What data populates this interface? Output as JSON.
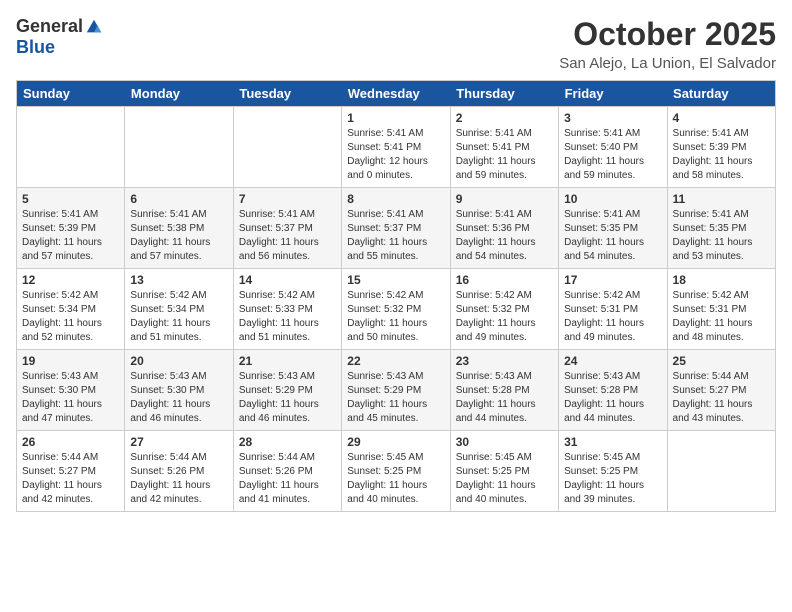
{
  "logo": {
    "general": "General",
    "blue": "Blue"
  },
  "header": {
    "month": "October 2025",
    "location": "San Alejo, La Union, El Salvador"
  },
  "weekdays": [
    "Sunday",
    "Monday",
    "Tuesday",
    "Wednesday",
    "Thursday",
    "Friday",
    "Saturday"
  ],
  "weeks": [
    [
      {
        "day": "",
        "info": ""
      },
      {
        "day": "",
        "info": ""
      },
      {
        "day": "",
        "info": ""
      },
      {
        "day": "1",
        "info": "Sunrise: 5:41 AM\nSunset: 5:41 PM\nDaylight: 12 hours\nand 0 minutes."
      },
      {
        "day": "2",
        "info": "Sunrise: 5:41 AM\nSunset: 5:41 PM\nDaylight: 11 hours\nand 59 minutes."
      },
      {
        "day": "3",
        "info": "Sunrise: 5:41 AM\nSunset: 5:40 PM\nDaylight: 11 hours\nand 59 minutes."
      },
      {
        "day": "4",
        "info": "Sunrise: 5:41 AM\nSunset: 5:39 PM\nDaylight: 11 hours\nand 58 minutes."
      }
    ],
    [
      {
        "day": "5",
        "info": "Sunrise: 5:41 AM\nSunset: 5:39 PM\nDaylight: 11 hours\nand 57 minutes."
      },
      {
        "day": "6",
        "info": "Sunrise: 5:41 AM\nSunset: 5:38 PM\nDaylight: 11 hours\nand 57 minutes."
      },
      {
        "day": "7",
        "info": "Sunrise: 5:41 AM\nSunset: 5:37 PM\nDaylight: 11 hours\nand 56 minutes."
      },
      {
        "day": "8",
        "info": "Sunrise: 5:41 AM\nSunset: 5:37 PM\nDaylight: 11 hours\nand 55 minutes."
      },
      {
        "day": "9",
        "info": "Sunrise: 5:41 AM\nSunset: 5:36 PM\nDaylight: 11 hours\nand 54 minutes."
      },
      {
        "day": "10",
        "info": "Sunrise: 5:41 AM\nSunset: 5:35 PM\nDaylight: 11 hours\nand 54 minutes."
      },
      {
        "day": "11",
        "info": "Sunrise: 5:41 AM\nSunset: 5:35 PM\nDaylight: 11 hours\nand 53 minutes."
      }
    ],
    [
      {
        "day": "12",
        "info": "Sunrise: 5:42 AM\nSunset: 5:34 PM\nDaylight: 11 hours\nand 52 minutes."
      },
      {
        "day": "13",
        "info": "Sunrise: 5:42 AM\nSunset: 5:34 PM\nDaylight: 11 hours\nand 51 minutes."
      },
      {
        "day": "14",
        "info": "Sunrise: 5:42 AM\nSunset: 5:33 PM\nDaylight: 11 hours\nand 51 minutes."
      },
      {
        "day": "15",
        "info": "Sunrise: 5:42 AM\nSunset: 5:32 PM\nDaylight: 11 hours\nand 50 minutes."
      },
      {
        "day": "16",
        "info": "Sunrise: 5:42 AM\nSunset: 5:32 PM\nDaylight: 11 hours\nand 49 minutes."
      },
      {
        "day": "17",
        "info": "Sunrise: 5:42 AM\nSunset: 5:31 PM\nDaylight: 11 hours\nand 49 minutes."
      },
      {
        "day": "18",
        "info": "Sunrise: 5:42 AM\nSunset: 5:31 PM\nDaylight: 11 hours\nand 48 minutes."
      }
    ],
    [
      {
        "day": "19",
        "info": "Sunrise: 5:43 AM\nSunset: 5:30 PM\nDaylight: 11 hours\nand 47 minutes."
      },
      {
        "day": "20",
        "info": "Sunrise: 5:43 AM\nSunset: 5:30 PM\nDaylight: 11 hours\nand 46 minutes."
      },
      {
        "day": "21",
        "info": "Sunrise: 5:43 AM\nSunset: 5:29 PM\nDaylight: 11 hours\nand 46 minutes."
      },
      {
        "day": "22",
        "info": "Sunrise: 5:43 AM\nSunset: 5:29 PM\nDaylight: 11 hours\nand 45 minutes."
      },
      {
        "day": "23",
        "info": "Sunrise: 5:43 AM\nSunset: 5:28 PM\nDaylight: 11 hours\nand 44 minutes."
      },
      {
        "day": "24",
        "info": "Sunrise: 5:43 AM\nSunset: 5:28 PM\nDaylight: 11 hours\nand 44 minutes."
      },
      {
        "day": "25",
        "info": "Sunrise: 5:44 AM\nSunset: 5:27 PM\nDaylight: 11 hours\nand 43 minutes."
      }
    ],
    [
      {
        "day": "26",
        "info": "Sunrise: 5:44 AM\nSunset: 5:27 PM\nDaylight: 11 hours\nand 42 minutes."
      },
      {
        "day": "27",
        "info": "Sunrise: 5:44 AM\nSunset: 5:26 PM\nDaylight: 11 hours\nand 42 minutes."
      },
      {
        "day": "28",
        "info": "Sunrise: 5:44 AM\nSunset: 5:26 PM\nDaylight: 11 hours\nand 41 minutes."
      },
      {
        "day": "29",
        "info": "Sunrise: 5:45 AM\nSunset: 5:25 PM\nDaylight: 11 hours\nand 40 minutes."
      },
      {
        "day": "30",
        "info": "Sunrise: 5:45 AM\nSunset: 5:25 PM\nDaylight: 11 hours\nand 40 minutes."
      },
      {
        "day": "31",
        "info": "Sunrise: 5:45 AM\nSunset: 5:25 PM\nDaylight: 11 hours\nand 39 minutes."
      },
      {
        "day": "",
        "info": ""
      }
    ]
  ]
}
